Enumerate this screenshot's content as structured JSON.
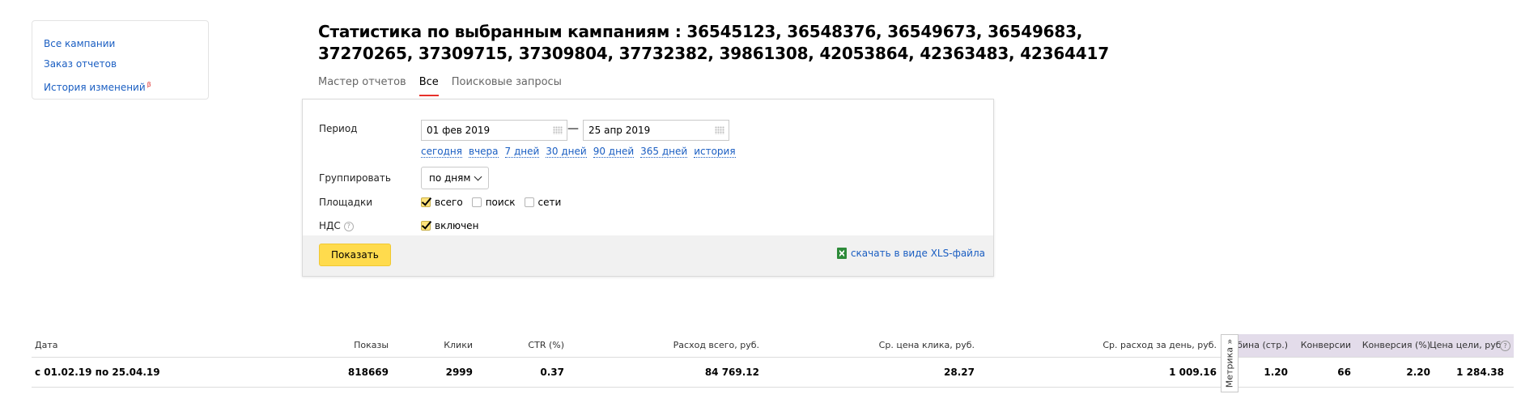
{
  "sidebar": {
    "items": [
      {
        "label": "Все кампании"
      },
      {
        "label": "Заказ отчетов"
      },
      {
        "label": "История изменений",
        "badge": "β"
      }
    ]
  },
  "page": {
    "title": "Статистика по выбранным кампаниям : 36545123, 36548376, 36549673, 36549683, 37270265, 37309715, 37309804, 37732382, 39861308, 42053864, 42363483, 42364417"
  },
  "tabs": [
    {
      "label": "Мастер отчетов",
      "active": false
    },
    {
      "label": "Все",
      "active": true
    },
    {
      "label": "Поисковые запросы",
      "active": false
    }
  ],
  "filters": {
    "period_label": "Период",
    "date_from": "01 фев 2019",
    "date_dash": "—",
    "date_to": "25 апр 2019",
    "quick_ranges": [
      "сегодня",
      "вчера",
      "7 дней",
      "30 дней",
      "90 дней",
      "365 дней",
      "история"
    ],
    "group_label": "Группировать",
    "group_value": "по дням",
    "platforms_label": "Площадки",
    "platforms": [
      {
        "label": "всего",
        "checked": true
      },
      {
        "label": "поиск",
        "checked": false
      },
      {
        "label": "сети",
        "checked": false
      }
    ],
    "vat_label": "НДС",
    "vat_help": "?",
    "vat_option": {
      "label": "включен",
      "checked": true
    },
    "show_button": "Показать",
    "xls_link": "скачать в виде XLS-файла"
  },
  "table": {
    "headers": {
      "date": "Дата",
      "impressions": "Показы",
      "clicks": "Клики",
      "ctr": "CTR (%)",
      "spend": "Расход всего, руб.",
      "cpc": "Ср. цена клика, руб.",
      "daily_spend": "Ср. расход за день, руб.",
      "metrika_tab": "Метрика »",
      "depth": "Глубина (стр.)",
      "conversions": "Конверсии",
      "conversion_rate": "Конверсия (%)",
      "goal_cost": "Цена цели, руб.",
      "goal_help": "?"
    },
    "rows": [
      {
        "date": "с 01.02.19 по 25.04.19",
        "impressions": "818669",
        "clicks": "2999",
        "ctr": "0.37",
        "spend": "84 769.12",
        "cpc": "28.27",
        "daily_spend": "1 009.16",
        "depth": "1.20",
        "conversions": "66",
        "conversion_rate": "2.20",
        "goal_cost": "1 284.38"
      }
    ]
  },
  "colors": {
    "link": "#1a5ec2",
    "active_tab_underline": "#e7312a",
    "primary_button": "#ffdb4d",
    "metrika_header_bg": "#e3dcea"
  }
}
